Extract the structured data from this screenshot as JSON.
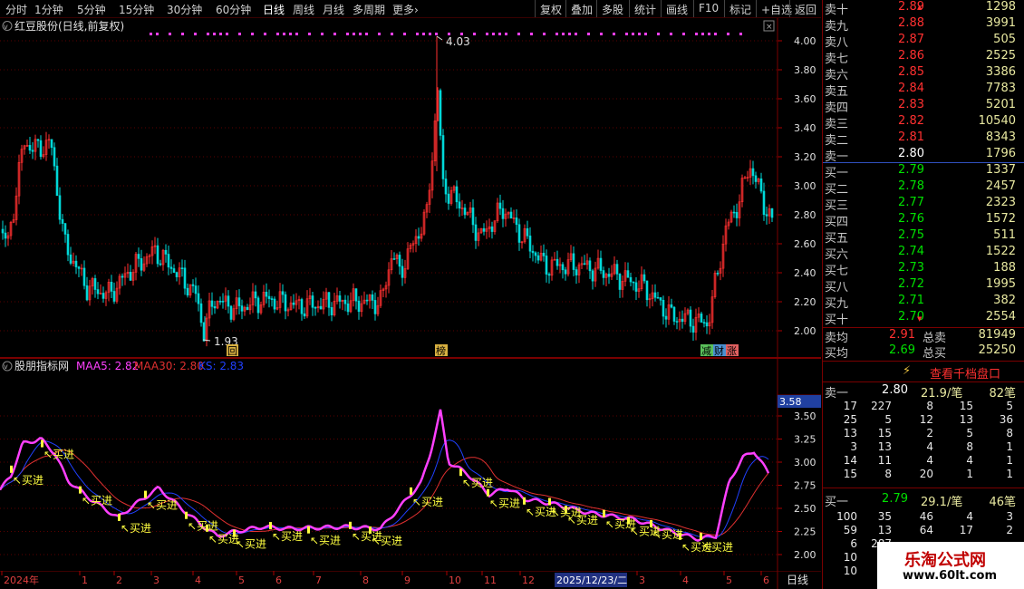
{
  "toolbar": {
    "periods": [
      "分时",
      "1分钟",
      "5分钟",
      "15分钟",
      "30分钟",
      "60分钟",
      "日线",
      "周线",
      "月线",
      "多周期",
      "更多"
    ],
    "active_period": "日线",
    "actions": [
      "复权",
      "叠加",
      "多股",
      "统计",
      "画线",
      "F10",
      "标记",
      "+自选",
      "返回"
    ]
  },
  "main_chart": {
    "title": "红豆股份(日线,前复权)",
    "y_ticks": [
      "4.00",
      "3.80",
      "3.60",
      "3.40",
      "3.20",
      "3.00",
      "2.80",
      "2.60",
      "2.40",
      "2.20",
      "2.00"
    ],
    "high_label": "4.03",
    "low_label": "1.93",
    "event_markers": [
      "回",
      "榜",
      "减",
      "财",
      "涨"
    ]
  },
  "indicator": {
    "name": "股朋指标网",
    "maa5_label": "MAA5: 2.82",
    "maa30_label": "MAA30: 2.80",
    "ks_label": "KS: 2.83",
    "y_ticks": [
      "3.50",
      "3.25",
      "3.00",
      "2.75",
      "2.50",
      "2.25",
      "2.00"
    ],
    "current_value": "3.58",
    "buy_signal": "买进"
  },
  "time_axis": {
    "labels": [
      "2024年",
      "1",
      "2",
      "3",
      "4",
      "5",
      "6",
      "7",
      "8",
      "9",
      "10",
      "11",
      "12",
      "2025/12/23/二",
      "3",
      "4",
      "5",
      "6"
    ],
    "period_label": "日线"
  },
  "order_book": {
    "asks": [
      {
        "label": "卖十",
        "price": "2.89",
        "volume": "1298"
      },
      {
        "label": "卖九",
        "price": "2.88",
        "volume": "3991"
      },
      {
        "label": "卖八",
        "price": "2.87",
        "volume": "505"
      },
      {
        "label": "卖七",
        "price": "2.86",
        "volume": "2525"
      },
      {
        "label": "卖六",
        "price": "2.85",
        "volume": "3386"
      },
      {
        "label": "卖五",
        "price": "2.84",
        "volume": "7783"
      },
      {
        "label": "卖四",
        "price": "2.83",
        "volume": "5201"
      },
      {
        "label": "卖三",
        "price": "2.82",
        "volume": "10540"
      },
      {
        "label": "卖二",
        "price": "2.81",
        "volume": "8343"
      },
      {
        "label": "卖一",
        "price": "2.80",
        "volume": "1796"
      }
    ],
    "bids": [
      {
        "label": "买一",
        "price": "2.79",
        "volume": "1337"
      },
      {
        "label": "买二",
        "price": "2.78",
        "volume": "2457"
      },
      {
        "label": "买三",
        "price": "2.77",
        "volume": "2323"
      },
      {
        "label": "买四",
        "price": "2.76",
        "volume": "1572"
      },
      {
        "label": "买五",
        "price": "2.75",
        "volume": "511"
      },
      {
        "label": "买六",
        "price": "2.74",
        "volume": "1522"
      },
      {
        "label": "买七",
        "price": "2.73",
        "volume": "188"
      },
      {
        "label": "买八",
        "price": "2.72",
        "volume": "1995"
      },
      {
        "label": "买九",
        "price": "2.71",
        "volume": "382"
      },
      {
        "label": "买十",
        "price": "2.70",
        "volume": "2554"
      }
    ],
    "ask_avg": {
      "label": "卖均",
      "price": "2.91",
      "total_label": "总卖",
      "total": "81949"
    },
    "bid_avg": {
      "label": "买均",
      "price": "2.69",
      "total_label": "总买",
      "total": "25250"
    },
    "view_button": "查看千档盘口",
    "ask_queue": {
      "label": "卖一",
      "price": "2.80",
      "per_trade": "21.9/笔",
      "count": "82笔",
      "rows": [
        [
          "17",
          "227",
          "8",
          "15",
          "5"
        ],
        [
          "25",
          "5",
          "12",
          "13",
          "36"
        ],
        [
          "13",
          "15",
          "2",
          "5",
          "8"
        ],
        [
          "3",
          "13",
          "4",
          "8",
          "1"
        ],
        [
          "14",
          "11",
          "4",
          "4",
          "1"
        ],
        [
          "15",
          "8",
          "20",
          "1",
          "1"
        ]
      ]
    },
    "bid_queue": {
      "label": "买一",
      "price": "2.79",
      "per_trade": "29.1/笔",
      "count": "46笔",
      "rows": [
        [
          "100",
          "35",
          "46",
          "4",
          "3"
        ],
        [
          "59",
          "13",
          "64",
          "17",
          "2"
        ],
        [
          "6",
          "287",
          "",
          "",
          ""
        ],
        [
          "10",
          "",
          "",
          "",
          ""
        ],
        [
          "10",
          "",
          "",
          "",
          ""
        ]
      ]
    }
  },
  "watermark": {
    "title": "乐淘公式网",
    "url": "www.60lt.com"
  },
  "colors": {
    "up": "#ff3030",
    "down": "#00d8d8",
    "maa5": "#ff40ff",
    "maa30": "#e03030",
    "ks": "#2040ff",
    "grid": "#5a0000",
    "signal": "#ffff40"
  }
}
